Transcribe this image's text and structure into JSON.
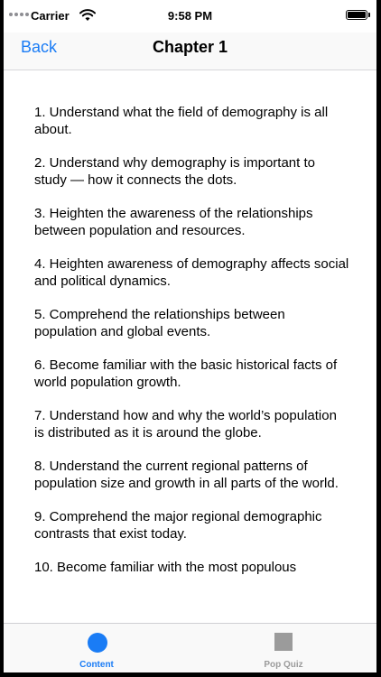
{
  "status_bar": {
    "carrier": "Carrier",
    "time": "9:58 PM",
    "icons": [
      "signal-icon",
      "wifi-icon",
      "battery-icon"
    ]
  },
  "nav": {
    "back_label": "Back",
    "title": "Chapter 1"
  },
  "objectives": [
    "1. Understand what the field of demography is all about.",
    "2. Understand why demography is important to study — how it connects the dots.",
    "3. Heighten the awareness of the relationships between population and resources.",
    "4. Heighten awareness of demography affects social and political dynamics.",
    "5. Comprehend the relationships between population and global events.",
    "6.  Become familiar with the basic historical facts of world population growth.",
    "7. Understand how and why the world’s population is distributed as it is around the globe.",
    "8. Understand the current regional patterns of population size and growth in all parts of the world.",
    "9. Comprehend the major regional demographic contrasts that exist today.",
    "10. Become familiar with the most populous"
  ],
  "tab_bar": {
    "tabs": [
      {
        "label": "Content",
        "icon": "circle-icon",
        "selected": true
      },
      {
        "label": "Pop Quiz",
        "icon": "square-icon",
        "selected": false
      }
    ]
  },
  "colors": {
    "accent": "#1a7cf5",
    "inactive": "#9b9b9b"
  }
}
